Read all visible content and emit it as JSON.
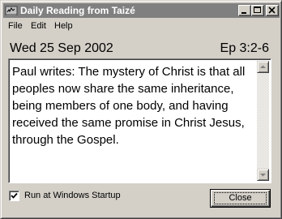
{
  "window": {
    "title": "Daily Reading from Taizé",
    "controls": {
      "minimize": "minimize-icon",
      "maximize": "maximize-icon",
      "close": "close-x-icon"
    }
  },
  "menu": {
    "items": [
      {
        "label": "File"
      },
      {
        "label": "Edit"
      },
      {
        "label": "Help"
      }
    ]
  },
  "reading": {
    "date": "Wed 25 Sep 2002",
    "reference": "Ep 3:2-6",
    "text": "Paul writes: The mystery of Christ is that all peoples now share the same inheritance, being members of one body, and having received the same promise in Christ Jesus, through the Gospel."
  },
  "startup": {
    "label": "Run at Windows Startup",
    "checked": true
  },
  "buttons": {
    "close_label": "Close"
  },
  "colors": {
    "face": "#d4d0c8",
    "titlebar_inactive": "#808080",
    "text_background": "#ffffff"
  }
}
